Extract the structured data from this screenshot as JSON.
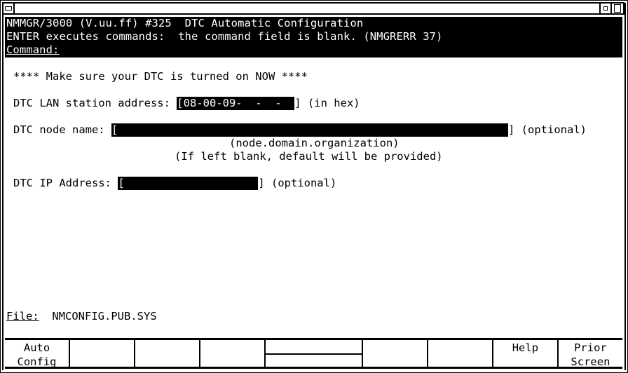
{
  "window": {
    "controls": [
      "system-menu",
      "minimize",
      "maximize"
    ]
  },
  "header": {
    "line1": "NMMGR/3000 (V.uu.ff) #325  DTC Automatic Configuration",
    "line2": "ENTER executes commands:  the command field is blank. (NMGRERR 37)",
    "command_label": "Command:",
    "command_value": ""
  },
  "form": {
    "warning": "**** Make sure your DTC is turned on NOW ****",
    "lan_address": {
      "label": "DTC LAN station address: ",
      "value": "08-00-09-  -  -  ",
      "suffix": " (in hex)"
    },
    "node_name": {
      "label": "DTC node name: ",
      "value": "",
      "suffix": " (optional)",
      "hint1": "(node.domain.organization)",
      "hint2": "(If left blank, default will be provided)"
    },
    "ip_address": {
      "label": "DTC IP Address: ",
      "value": "",
      "suffix": " (optional)"
    },
    "file": {
      "label": "File:",
      "value": "NMCONFIG.PUB.SYS"
    }
  },
  "softkeys": [
    {
      "id": "f1",
      "label": "Auto\nConfig"
    },
    {
      "id": "f2",
      "label": ""
    },
    {
      "id": "f3",
      "label": ""
    },
    {
      "id": "f4",
      "label": ""
    },
    {
      "id": "f5",
      "label": ""
    },
    {
      "id": "f6",
      "label": ""
    },
    {
      "id": "f7",
      "label": ""
    },
    {
      "id": "f8",
      "label": "Help"
    },
    {
      "id": "f9",
      "label": "Prior\nScreen"
    }
  ]
}
